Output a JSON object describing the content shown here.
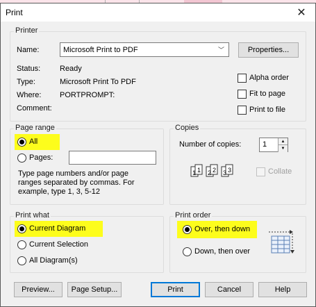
{
  "window": {
    "title": "Print"
  },
  "printer": {
    "group_label": "Printer",
    "name_label": "Name:",
    "name_value": "Microsoft Print to PDF",
    "properties_label": "Properties...",
    "status_label": "Status:",
    "status_value": "Ready",
    "type_label": "Type:",
    "type_value": "Microsoft Print To PDF",
    "where_label": "Where:",
    "where_value": "PORTPROMPT:",
    "comment_label": "Comment:",
    "alpha_order_label": "Alpha order",
    "fit_to_page_label": "Fit to page",
    "print_to_file_label": "Print to file"
  },
  "page_range": {
    "group_label": "Page range",
    "all_label": "All",
    "pages_label": "Pages:",
    "pages_value": "",
    "help_text": "Type page numbers and/or page ranges separated by commas. For example, type 1, 3, 5-12"
  },
  "copies": {
    "group_label": "Copies",
    "number_label": "Number of copies:",
    "number_value": "1",
    "collate_label": "Collate"
  },
  "print_what": {
    "group_label": "Print what",
    "current_diagram_label": "Current Diagram",
    "current_selection_label": "Current Selection",
    "all_diagrams_label": "All Diagram(s)"
  },
  "print_order": {
    "group_label": "Print order",
    "over_then_down_label": "Over, then down",
    "down_then_over_label": "Down, then over"
  },
  "buttons": {
    "preview": "Preview...",
    "page_setup": "Page Setup...",
    "print": "Print",
    "cancel": "Cancel",
    "help": "Help"
  },
  "colors": {
    "highlight": "#fdfd1c",
    "accent": "#0078d7"
  }
}
